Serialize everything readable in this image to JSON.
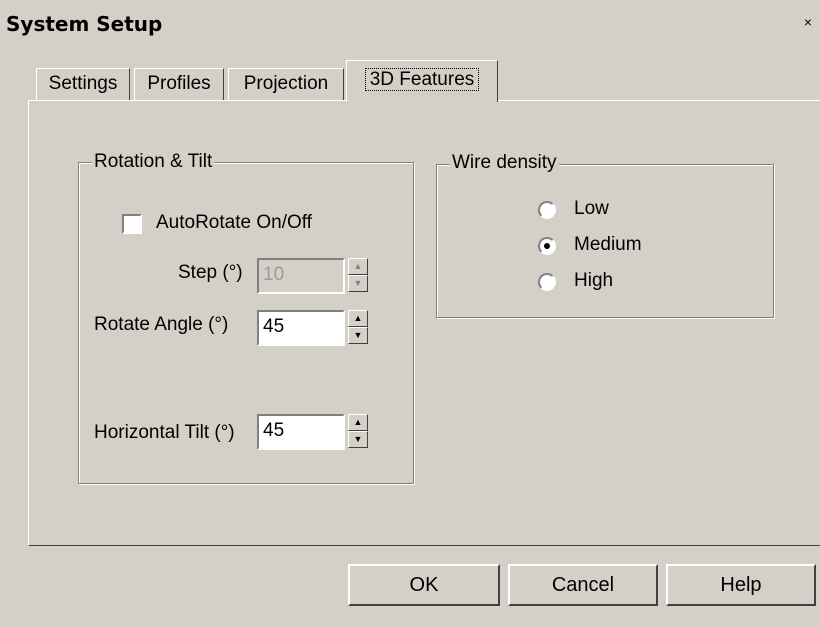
{
  "window": {
    "title": "System Setup",
    "close_glyph": "×"
  },
  "tabs": [
    {
      "label": "Settings"
    },
    {
      "label": "Profiles"
    },
    {
      "label": "Projection"
    },
    {
      "label": "3D Features"
    }
  ],
  "rotation_group": {
    "title": "Rotation & Tilt",
    "autorotate_label": "AutoRotate On/Off",
    "autorotate_checked": false,
    "step_label": "Step (°)",
    "step_value": "10",
    "rotate_angle_label": "Rotate Angle (°)",
    "rotate_angle_value": "45",
    "horizontal_tilt_label": "Horizontal Tilt (°)",
    "horizontal_tilt_value": "45"
  },
  "wire_group": {
    "title": "Wire density",
    "options": [
      {
        "label": "Low",
        "selected": false
      },
      {
        "label": "Medium",
        "selected": true
      },
      {
        "label": "High",
        "selected": false
      }
    ]
  },
  "buttons": {
    "ok": "OK",
    "cancel": "Cancel",
    "help": "Help"
  },
  "spinner_glyphs": {
    "up": "▲",
    "down": "▼"
  }
}
